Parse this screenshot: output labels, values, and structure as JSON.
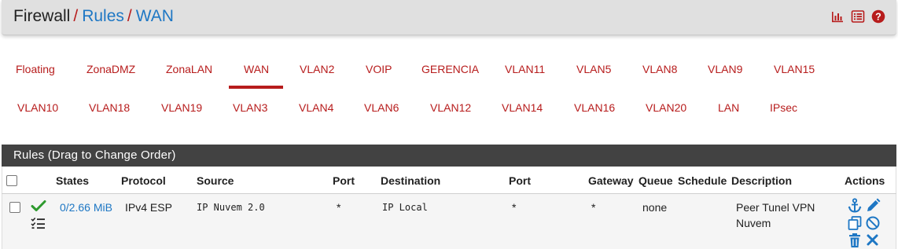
{
  "breadcrumb": {
    "root": "Firewall",
    "sep1": "/",
    "level2": "Rules",
    "sep2": "/",
    "level3": "WAN"
  },
  "header_icons": [
    "bar-chart-icon",
    "list-icon",
    "help-icon"
  ],
  "tabs": {
    "row1": [
      "Floating",
      "ZonaDMZ",
      "ZonaLAN",
      "WAN",
      "VLAN2",
      "VOIP",
      "GERENCIA",
      "VLAN11",
      "VLAN5",
      "VLAN8",
      "VLAN9",
      "VLAN15"
    ],
    "row2": [
      "VLAN10",
      "VLAN18",
      "VLAN19",
      "VLAN3",
      "VLAN4",
      "VLAN6",
      "VLAN12",
      "VLAN14",
      "VLAN16",
      "VLAN20",
      "LAN",
      "IPsec"
    ],
    "active": "WAN"
  },
  "panel": {
    "title": "Rules (Drag to Change Order)"
  },
  "table": {
    "headers": {
      "states": "States",
      "protocol": "Protocol",
      "source": "Source",
      "port": "Port",
      "destination": "Destination",
      "port2": "Port",
      "gateway": "Gateway",
      "queue": "Queue",
      "schedule": "Schedule",
      "description": "Description",
      "actions": "Actions"
    },
    "rows": [
      {
        "states": "0/2.66 MiB",
        "protocol": "IPv4 ESP",
        "source": "IP Nuvem 2.0",
        "port": "*",
        "destination": "IP Local",
        "port2": "*",
        "gateway": "*",
        "queue": "none",
        "schedule": "",
        "description_line1": "Peer Tunel VPN",
        "description_line2": "Nuvem",
        "status_icons": [
          "check-icon",
          "tasks-list-icon"
        ],
        "action_icons": [
          "anchor-icon",
          "pencil-icon",
          "copy-icon",
          "disable-icon",
          "trash-icon",
          "delete-x-icon"
        ]
      }
    ]
  },
  "colors": {
    "accent_red": "#b71c1c",
    "link_blue": "#1e77c4",
    "panel_heading": "#424242",
    "header_bg": "#e0e0e0",
    "pass_green": "#2e9a2e"
  }
}
